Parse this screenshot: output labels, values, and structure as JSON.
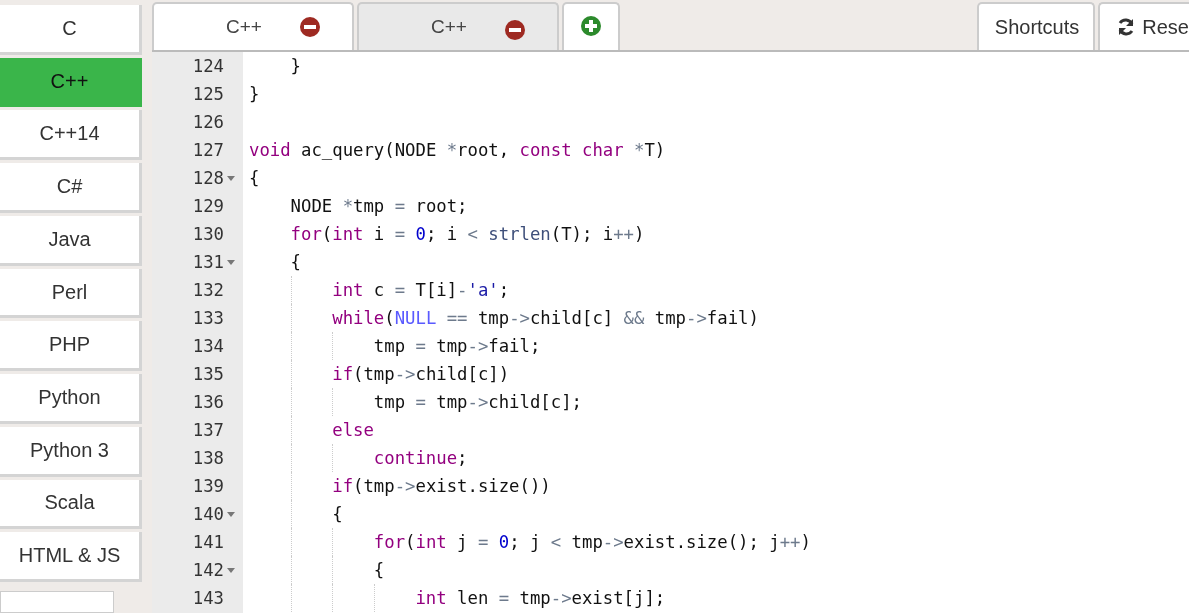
{
  "languages": [
    {
      "label": "C",
      "selected": false
    },
    {
      "label": "C++",
      "selected": true
    },
    {
      "label": "C++14",
      "selected": false
    },
    {
      "label": "C#",
      "selected": false
    },
    {
      "label": "Java",
      "selected": false
    },
    {
      "label": "Perl",
      "selected": false
    },
    {
      "label": "PHP",
      "selected": false
    },
    {
      "label": "Python",
      "selected": false
    },
    {
      "label": "Python 3",
      "selected": false
    },
    {
      "label": "Scala",
      "selected": false
    },
    {
      "label": "HTML & JS",
      "selected": false
    }
  ],
  "tabs": [
    {
      "label": "C++",
      "selected": true
    },
    {
      "label": "C++",
      "selected": false
    }
  ],
  "toolbar": {
    "shortcuts": "Shortcuts",
    "reset": "Rese"
  },
  "code_lines": [
    {
      "number": "124",
      "foldable": false,
      "tokens": [
        {
          "kind": "plain",
          "text": "    }"
        }
      ]
    },
    {
      "number": "125",
      "foldable": false,
      "tokens": [
        {
          "kind": "plain",
          "text": "}"
        }
      ]
    },
    {
      "number": "126",
      "foldable": false
    },
    {
      "number": "127",
      "foldable": false,
      "tokens": [
        {
          "kind": "kw",
          "text": "void"
        },
        {
          "kind": "plain",
          "text": " ac_query(NODE "
        },
        {
          "kind": "op",
          "text": "*"
        },
        {
          "kind": "plain",
          "text": "root, "
        },
        {
          "kind": "kw",
          "text": "const"
        },
        {
          "kind": "kw",
          "text": " char"
        },
        {
          "kind": "op",
          "text": " *"
        },
        {
          "kind": "plain",
          "text": "T)"
        }
      ]
    },
    {
      "number": "128",
      "foldable": true,
      "tokens": [
        {
          "kind": "plain",
          "text": "{"
        }
      ]
    },
    {
      "number": "129",
      "foldable": false,
      "tokens": [
        {
          "kind": "plain",
          "text": "    NODE "
        },
        {
          "kind": "op",
          "text": "*"
        },
        {
          "kind": "plain",
          "text": "tmp "
        },
        {
          "kind": "op",
          "text": "="
        },
        {
          "kind": "plain",
          "text": " root;"
        }
      ]
    },
    {
      "number": "130",
      "foldable": false,
      "tokens": [
        {
          "kind": "kw",
          "text": "    for"
        },
        {
          "kind": "plain",
          "text": "("
        },
        {
          "kind": "kw",
          "text": "int"
        },
        {
          "kind": "plain",
          "text": " i "
        },
        {
          "kind": "op",
          "text": "="
        },
        {
          "kind": "num",
          "text": " 0"
        },
        {
          "kind": "plain",
          "text": "; i "
        },
        {
          "kind": "op",
          "text": "<"
        },
        {
          "kind": "fn",
          "text": " strlen"
        },
        {
          "kind": "plain",
          "text": "(T); i"
        },
        {
          "kind": "op",
          "text": "++"
        },
        {
          "kind": "plain",
          "text": ")"
        }
      ]
    },
    {
      "number": "131",
      "foldable": true,
      "tokens": [
        {
          "kind": "plain",
          "text": "    {"
        }
      ]
    },
    {
      "number": "132",
      "foldable": false,
      "tokens": [
        {
          "kind": "kw",
          "text": "        int"
        },
        {
          "kind": "plain",
          "text": " c "
        },
        {
          "kind": "op",
          "text": "="
        },
        {
          "kind": "plain",
          "text": " T[i]"
        },
        {
          "kind": "op",
          "text": "-"
        },
        {
          "kind": "str",
          "text": "'a'"
        },
        {
          "kind": "plain",
          "text": ";"
        }
      ]
    },
    {
      "number": "133",
      "foldable": false,
      "tokens": [
        {
          "kind": "kw",
          "text": "        while"
        },
        {
          "kind": "plain",
          "text": "("
        },
        {
          "kind": "const",
          "text": "NULL"
        },
        {
          "kind": "op",
          "text": " =="
        },
        {
          "kind": "plain",
          "text": " tmp"
        },
        {
          "kind": "op",
          "text": "->"
        },
        {
          "kind": "plain",
          "text": "child[c] "
        },
        {
          "kind": "op",
          "text": "&&"
        },
        {
          "kind": "plain",
          "text": " tmp"
        },
        {
          "kind": "op",
          "text": "->"
        },
        {
          "kind": "plain",
          "text": "fail)"
        }
      ]
    },
    {
      "number": "134",
      "foldable": false,
      "tokens": [
        {
          "kind": "plain",
          "text": "            tmp "
        },
        {
          "kind": "op",
          "text": "="
        },
        {
          "kind": "plain",
          "text": " tmp"
        },
        {
          "kind": "op",
          "text": "->"
        },
        {
          "kind": "plain",
          "text": "fail;"
        }
      ]
    },
    {
      "number": "135",
      "foldable": false,
      "tokens": [
        {
          "kind": "kw",
          "text": "        if"
        },
        {
          "kind": "plain",
          "text": "(tmp"
        },
        {
          "kind": "op",
          "text": "->"
        },
        {
          "kind": "plain",
          "text": "child[c])"
        }
      ]
    },
    {
      "number": "136",
      "foldable": false,
      "tokens": [
        {
          "kind": "plain",
          "text": "            tmp "
        },
        {
          "kind": "op",
          "text": "="
        },
        {
          "kind": "plain",
          "text": " tmp"
        },
        {
          "kind": "op",
          "text": "->"
        },
        {
          "kind": "plain",
          "text": "child[c];"
        }
      ]
    },
    {
      "number": "137",
      "foldable": false,
      "tokens": [
        {
          "kind": "kw",
          "text": "        else"
        }
      ]
    },
    {
      "number": "138",
      "foldable": false,
      "tokens": [
        {
          "kind": "kw",
          "text": "            continue"
        },
        {
          "kind": "plain",
          "text": ";"
        }
      ]
    },
    {
      "number": "139",
      "foldable": false,
      "tokens": [
        {
          "kind": "kw",
          "text": "        if"
        },
        {
          "kind": "plain",
          "text": "(tmp"
        },
        {
          "kind": "op",
          "text": "->"
        },
        {
          "kind": "plain",
          "text": "exist.size())"
        }
      ]
    },
    {
      "number": "140",
      "foldable": true,
      "tokens": [
        {
          "kind": "plain",
          "text": "        {"
        }
      ]
    },
    {
      "number": "141",
      "foldable": false,
      "tokens": [
        {
          "kind": "kw",
          "text": "            for"
        },
        {
          "kind": "plain",
          "text": "("
        },
        {
          "kind": "kw",
          "text": "int"
        },
        {
          "kind": "plain",
          "text": " j "
        },
        {
          "kind": "op",
          "text": "="
        },
        {
          "kind": "num",
          "text": " 0"
        },
        {
          "kind": "plain",
          "text": "; j "
        },
        {
          "kind": "op",
          "text": "<"
        },
        {
          "kind": "plain",
          "text": " tmp"
        },
        {
          "kind": "op",
          "text": "->"
        },
        {
          "kind": "plain",
          "text": "exist.size(); j"
        },
        {
          "kind": "op",
          "text": "++"
        },
        {
          "kind": "plain",
          "text": ")"
        }
      ]
    },
    {
      "number": "142",
      "foldable": true,
      "tokens": [
        {
          "kind": "plain",
          "text": "            {"
        }
      ]
    },
    {
      "number": "143",
      "foldable": false,
      "tokens": [
        {
          "kind": "kw",
          "text": "                int"
        },
        {
          "kind": "plain",
          "text": " len "
        },
        {
          "kind": "op",
          "text": "="
        },
        {
          "kind": "plain",
          "text": " tmp"
        },
        {
          "kind": "op",
          "text": "->"
        },
        {
          "kind": "plain",
          "text": "exist[j];"
        }
      ]
    }
  ]
}
